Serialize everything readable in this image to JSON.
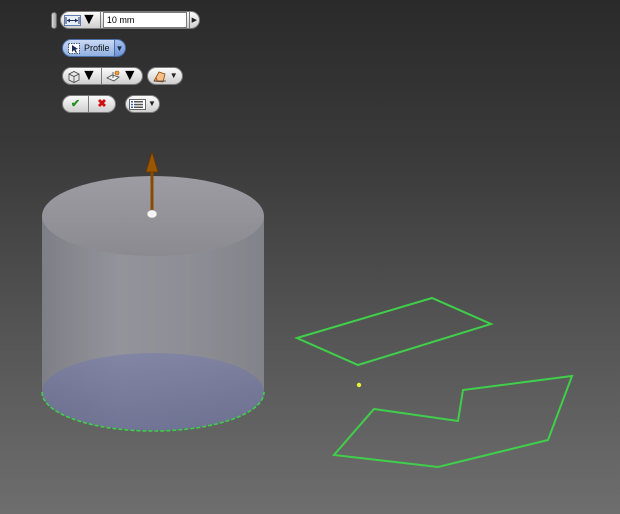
{
  "mini_toolbar": {
    "distance_value": "10 mm",
    "profile_label": "Profile"
  },
  "colors": {
    "background_top": "#2a2a2a",
    "background_bottom": "#6e6e6e",
    "cylinder_body": "#8b8b93",
    "sketch_green": "#3fcf4a",
    "manipulator_arrow": "#8a4a00",
    "profile_highlight": "#8fb0e2"
  },
  "icons": {
    "distance": "distance-icon",
    "profile": "profile-select-icon",
    "output": "output-solid-icon",
    "start": "extrude-start-icon",
    "taper": "taper-icon",
    "ok": "check-icon",
    "cancel": "x-icon",
    "options": "options-menu-icon"
  }
}
